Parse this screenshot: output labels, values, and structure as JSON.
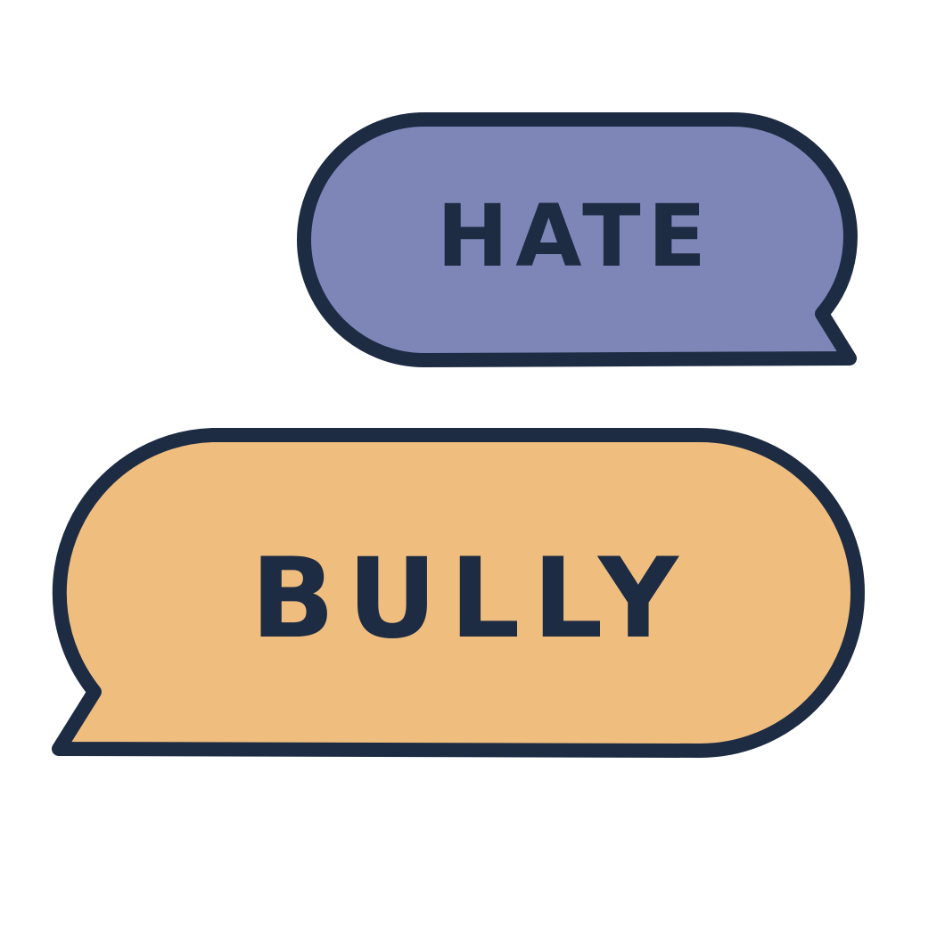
{
  "bubbles": {
    "top": {
      "text": "HATE",
      "fill": "#7E86B8",
      "icon": "speech-bubble-icon"
    },
    "bottom": {
      "text": "BULLY",
      "fill": "#EFBE7F",
      "icon": "speech-bubble-icon"
    }
  },
  "colors": {
    "outline": "#1D2B43",
    "background": "#FFFFFF"
  }
}
